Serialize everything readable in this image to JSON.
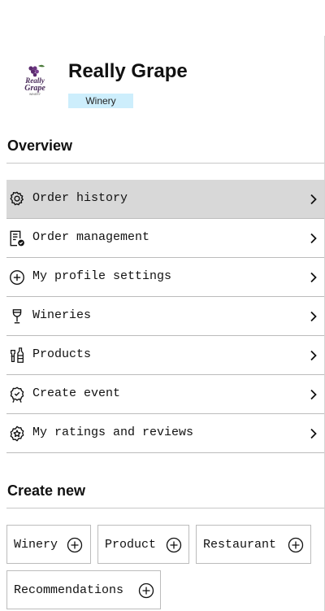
{
  "brand": {
    "name": "Really Grape",
    "badge": "Winery",
    "logo_text_top": "Really",
    "logo_text_bottom": "Grape",
    "logo_text_sub": "WINERY",
    "badge_color": "#cdeefc"
  },
  "overview": {
    "title": "Overview",
    "items": [
      {
        "label": "Order history",
        "icon": "gear-icon",
        "active": true
      },
      {
        "label": "Order management",
        "icon": "clipboard-check-icon",
        "active": false
      },
      {
        "label": "My profile settings",
        "icon": "plus-circle-icon",
        "active": false
      },
      {
        "label": "Wineries",
        "icon": "wine-glass-icon",
        "active": false
      },
      {
        "label": "Products",
        "icon": "bottles-icon",
        "active": false
      },
      {
        "label": "Create event",
        "icon": "award-badge-icon",
        "active": false
      },
      {
        "label": "My ratings and reviews",
        "icon": "star-badge-icon",
        "active": false
      }
    ]
  },
  "create_new": {
    "title": "Create new",
    "buttons": [
      {
        "label": "Winery",
        "icon": "plus-circle-icon"
      },
      {
        "label": "Product",
        "icon": "plus-circle-icon"
      },
      {
        "label": "Restaurant",
        "icon": "plus-circle-icon"
      },
      {
        "label": "Recommendations",
        "icon": "plus-circle-icon"
      }
    ]
  },
  "colors": {
    "active_row": "#d8d8d8",
    "divider": "#bcbcbc",
    "grape": "#5b2a6e",
    "leaf": "#4a7a3a"
  }
}
